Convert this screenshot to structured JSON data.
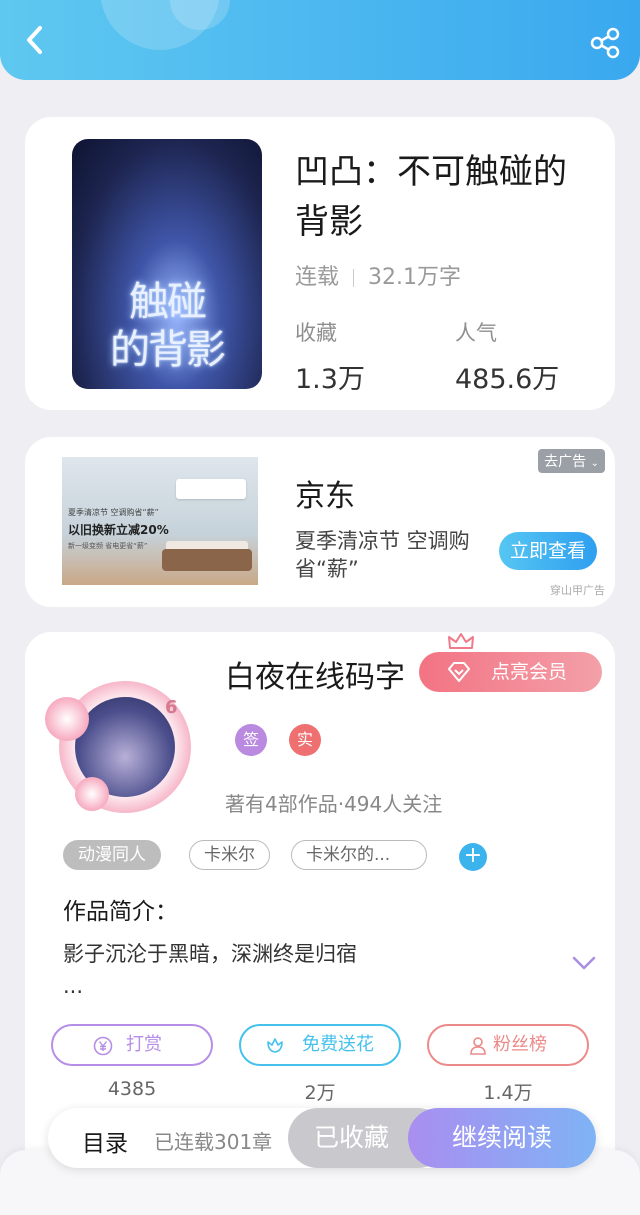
{
  "book": {
    "title": "凹凸：不可触碰的背影",
    "status": "连载",
    "word_count": "32.1万字",
    "collect_label": "收藏",
    "collect_value": "1.3万",
    "popularity_label": "人气",
    "popularity_value": "485.6万",
    "cover_title_line1": "触碰",
    "cover_title_line2": "的背影"
  },
  "ad": {
    "remove_label": "去广告",
    "brand": "京东",
    "description": "夏季清凉节 空调购省“薪”",
    "cta": "立即查看",
    "source": "穿山甲广告",
    "image_line1": "夏季清凉节 空调购省“薪”",
    "image_line2": "以旧换新立减20%",
    "image_line3": "新一级变频 省电更省“薪”"
  },
  "author": {
    "name": "白夜在线码字",
    "level": "6",
    "vip_button": "点亮会员",
    "badge_sign": "签",
    "badge_real": "实",
    "stats": "著有4部作品·494人关注",
    "tags": [
      "动漫同人",
      "卡米尔",
      "卡米尔的..."
    ],
    "add_tag": "+",
    "intro_heading": "作品简介：",
    "intro_text": "影子沉沦于黑暗，深渊终是归宿",
    "intro_ellipsis": "..."
  },
  "actions": [
    {
      "label": "打赏",
      "count": "4385",
      "color": "#b68ee6"
    },
    {
      "label": "免费送花",
      "count": "2万",
      "color": "#45c1ec"
    },
    {
      "label": "粉丝榜",
      "count": "1.4万",
      "color": "#ec8a8a"
    }
  ],
  "bottom_bar": {
    "toc": "目录",
    "serialized": "已连载301章",
    "collected": "已收藏",
    "continue": "继续阅读"
  },
  "icons": {
    "back": "chevron-left-icon",
    "share": "share-icon",
    "expand": "chevron-down-icon",
    "vip": "diamond-icon",
    "crown": "crown-icon",
    "reward": "yen-coin-icon",
    "flower": "flower-icon",
    "fans": "user-icon"
  },
  "colors": {
    "header_start": "#5fc8f0",
    "header_end": "#3aa8ef",
    "vip_start": "#f37383",
    "continue_start": "#a98ef0",
    "continue_end": "#7fb3f5"
  }
}
